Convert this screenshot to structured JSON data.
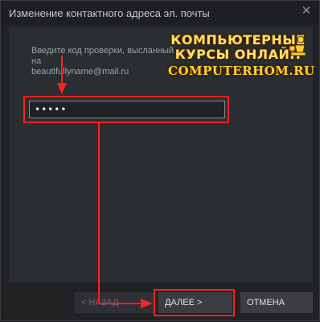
{
  "dialog": {
    "title": "Изменение контактного адреса эл. почты",
    "instruction_line1": "Введите код проверки, высланный на",
    "instruction_line2": "beautifullyname@mail.ru",
    "code_value": "•••••"
  },
  "buttons": {
    "back": "< НАЗАД",
    "next": "ДАЛЕЕ >",
    "cancel": "ОТМЕНА"
  },
  "watermark": {
    "line1": "КОМПЬЮТЕРНЫЕ",
    "line2": "КУРСЫ  ОНЛАЙН",
    "line3": "COMPUTERHOM.RU"
  },
  "colors": {
    "highlight": "#ff2020",
    "background": "#202224",
    "panel": "#2a2d31"
  },
  "icons": {
    "close": "close-icon",
    "logo": "logo-icon"
  }
}
